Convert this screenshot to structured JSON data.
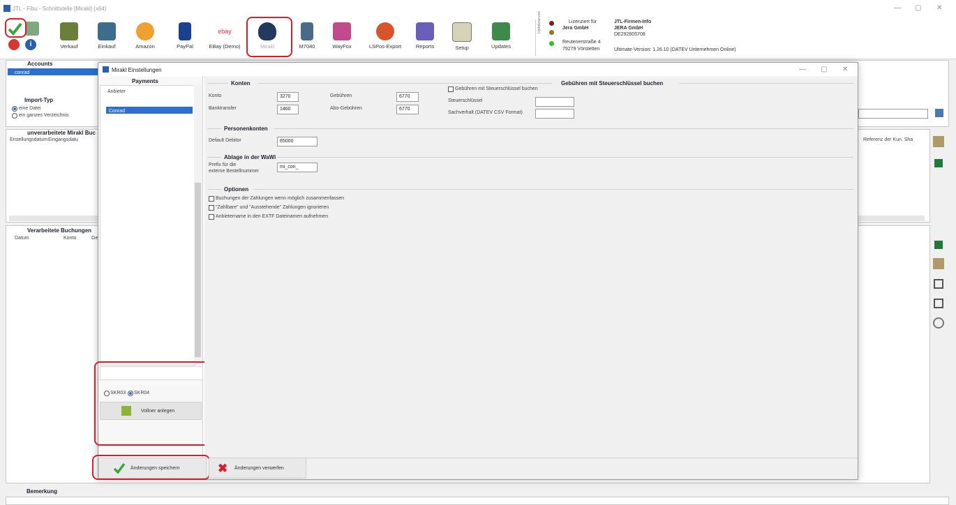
{
  "window": {
    "title": "JTL - Fibu - Schnittstelle [Mirakl] (x64)",
    "min": "—",
    "max": "▢",
    "close": "✕"
  },
  "toolbar": {
    "items": [
      "Verkauf",
      "Einkauf",
      "Amazon",
      "PayPal",
      "EBay (Demo)",
      "Mirakl",
      "M7040",
      "WayFox",
      "LSPos-Export",
      "Reports",
      "Setup",
      "Updates"
    ],
    "ebay_text": "ebay"
  },
  "license": {
    "lizenziert_label": "Lizenziert für",
    "company": "Jera GmbH",
    "street": "Reutenerstraße 4",
    "city": "79279 Vörstetten",
    "firm_info_title": "JTL-Firmen-Info",
    "firm_name": "JERA GmbH",
    "firm_id": "DE292605708",
    "version": "Ultimate-Version: 1.26.10 (DATEV Unternehmen Online)",
    "service_vertical": "Updateservice"
  },
  "background": {
    "accounts_title": "Accounts",
    "accounts_row": "conrad",
    "import_typ_title": "Import-Typ",
    "import_opt1": "eine Datei",
    "import_opt2": "ein ganzes Verzeichnis",
    "unverarbeitet_title": "unverarbeitete Mirakl Buc",
    "col_erstellung": "Erstellungsdatum",
    "col_eingang": "Eingangsdatu",
    "col_referenz": "Referenz der Kun. Sha",
    "verarbeitet_title": "Verarbeitete Buchungen",
    "col_datum": "Datum",
    "col_konto": "Konto",
    "col_ge": "Ge",
    "bemerkung_title": "Bemerkung"
  },
  "dialog": {
    "title": "Mirakl Einstellungen",
    "payments_title": "Payments",
    "anbieter_header": "Anbieter",
    "anbieter_row": "Conrad",
    "radio_skr03": "SKR03",
    "radio_skr04": "SKR04",
    "vollner_btn": "Vollner anlegen",
    "konten_title": "Konten",
    "konto_label": "Konto",
    "konto_value": "3270",
    "banktransfer_label": "Banktransfer",
    "banktransfer_value": "1460",
    "gebuehren_label": "Gebühren",
    "gebuehren_value": "6770",
    "abo_label": "Abo-Gebühren",
    "abo_value": "6770",
    "steuer_title": "Gebühren mit Steuerschlüssel buchen",
    "steuer_chk": "Gebühren mit Steuerschlüssel buchen",
    "steuerschluessel_label": "Steuerschlüssel",
    "sachverhalt_label": "Sachverhalt (DATEV CSV Format)",
    "personen_title": "Personenkonten",
    "debitor_label": "Default Debitor",
    "debitor_value": "65000",
    "ablage_title": "Ablage in der WaWi",
    "prefix_label_1": "Prefix für die",
    "prefix_label_2": "externe Bestellnummer",
    "prefix_value": "mi_con_",
    "optionen_title": "Optionen",
    "opt1": "Buchungen der Zahlungen wenn möglich zusammenfassen",
    "opt2": "\"Zahlbare\" und \"Ausstehende\" Zahlungen ignorieren",
    "opt3": "Anbietername in den EXTF Dateinamen aufnehmen",
    "save_btn": "Änderungen speichern",
    "discard_btn": "Änderungen verwerfen"
  },
  "colors": {
    "red_highlight": "#d81e2a",
    "selection": "#2c6fd1",
    "green_check": "#3aa53a"
  }
}
